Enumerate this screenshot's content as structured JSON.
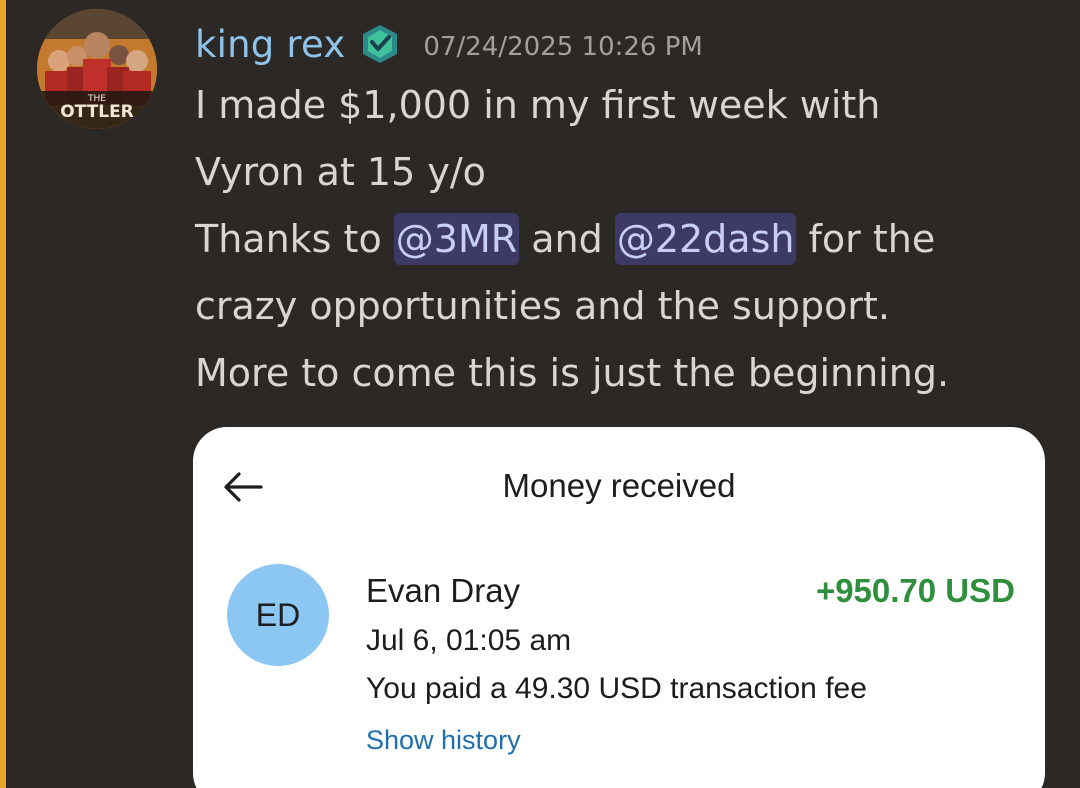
{
  "colors": {
    "background": "#2b2825",
    "accent_rail": "#e7a52b",
    "username": "#8fc3ea",
    "mention_bg": "#3d3a65",
    "amount_positive": "#2f8f3c",
    "link": "#1f6fae"
  },
  "message": {
    "author": {
      "username": "king rex",
      "avatar_icon": "avatar-image",
      "avatar_text": "THE BOTTLERS",
      "badge_icon": "server-badge-icon"
    },
    "timestamp": "07/24/2025 10:26 PM",
    "line1": "I made $1,000 in my first week with",
    "line2": "Vyron at 15 y/o",
    "line3_prefix": "Thanks to ",
    "mention1": "@3MR",
    "line3_mid": " and ",
    "mention2": "@22dash",
    "line3_suffix": " for the",
    "line4": "crazy opportunities and the support.",
    "line5": "More to come this is just the beginning."
  },
  "attachment": {
    "title": "Money received",
    "back_icon": "back-arrow-icon",
    "sender_initials": "ED",
    "sender_name": "Evan Dray",
    "amount": "+950.70 USD",
    "date": "Jul 6, 01:05 am",
    "fee_text": "You paid a 49.30 USD transaction fee",
    "history_link": "Show history"
  }
}
